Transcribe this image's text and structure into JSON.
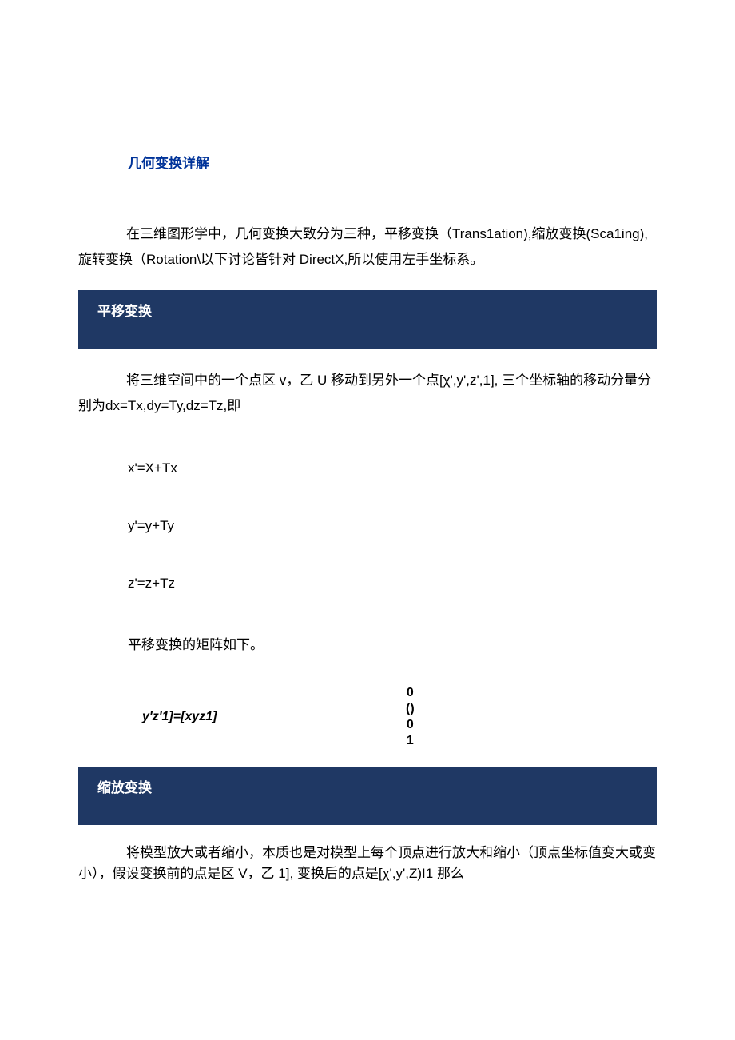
{
  "title": "几何变换详解",
  "intro": "在三维图形学中，几何变换大致分为三种，平移变换（Trans1ation),缩放变换(Sca1ing),旋转变换（Rotation\\以下讨论皆针对 DirectX,所以使用左手坐标系。",
  "sections": {
    "translation": {
      "header": "平移变换",
      "para1": "将三维空间中的一个点区 v，乙 U 移动到另外一个点[χ',y',z',1], 三个坐标轴的移动分量分别为dx=Tx,dy=Ty,dz=Tz,即",
      "eq1": "x'=X+Tx",
      "eq2": "y'=y+Ty",
      "eq3": "z'=z+Tz",
      "para2": "平移变换的矩阵如下。",
      "matrix_left": "y'z'1]=[xyz1]",
      "matrix_col": [
        "0",
        "()",
        "0",
        "1"
      ]
    },
    "scaling": {
      "header": "缩放变换",
      "para1": "将模型放大或者缩小，本质也是对模型上每个顶点进行放大和缩小（顶点坐标值变大或变小），假设变换前的点是区 V，乙 1], 变换后的点是[χ',y',Z)I1 那么"
    }
  }
}
